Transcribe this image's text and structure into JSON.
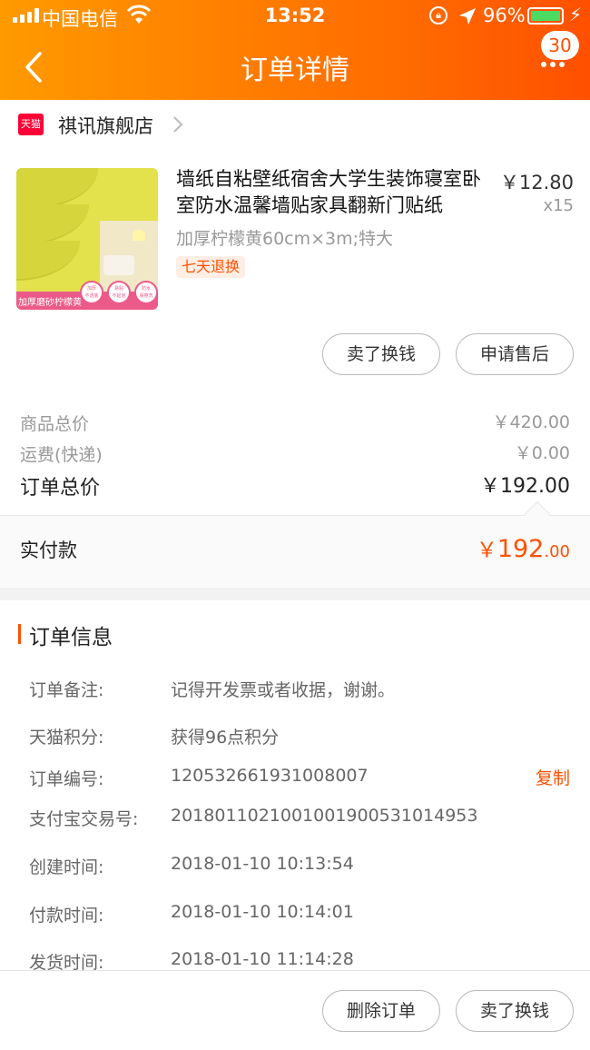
{
  "status_bar": {
    "carrier": "中国电信",
    "time": "13:52",
    "battery": "96%",
    "battery_level": 0.96
  },
  "nav": {
    "title": "订单详情",
    "badge": "30"
  },
  "shop": {
    "logo_text": "天猫",
    "name": "祺讯旗舰店"
  },
  "product": {
    "title": "墙纸自粘壁纸宿舍大学生装饰寝室卧室防水温馨墙贴家具翻新门贴纸",
    "price": "￥12.80",
    "quantity": "x15",
    "spec": "加厚柠檬黄60cm×3m;特大",
    "tag": "七天退换",
    "image_caption": "加厚磨砂柠檬黄"
  },
  "product_actions": {
    "sell_label": "卖了换钱",
    "after_sale_label": "申请售后"
  },
  "summary": {
    "goods_total_label": "商品总价",
    "goods_total_value": "￥420.00",
    "shipping_label": "运费(快递)",
    "shipping_value": "￥0.00",
    "order_total_label": "订单总价",
    "order_total_value": "￥192.00",
    "paid_label": "实付款",
    "paid_currency": "￥",
    "paid_integer": "192",
    "paid_decimal": ".00"
  },
  "order_info": {
    "title": "订单信息",
    "rows": [
      {
        "label": "订单备注:",
        "value": "记得开发票或者收据，谢谢。"
      },
      {
        "label": "天猫积分:",
        "value": "获得96点积分"
      },
      {
        "label": "订单编号:",
        "value": "120532661931008007"
      },
      {
        "label": "支付宝交易号:",
        "value": "2018011021001001900531014953"
      },
      {
        "label": "创建时间:",
        "value": "2018-01-10 10:13:54"
      },
      {
        "label": "付款时间:",
        "value": "2018-01-10 10:14:01"
      },
      {
        "label": "发货时间:",
        "value": "2018-01-10 11:14:28"
      }
    ],
    "copy_label": "复制"
  },
  "footer": {
    "delete_label": "删除订单",
    "sell_label": "卖了换钱"
  },
  "colors": {
    "accent": "#ff5000",
    "header_start": "#ff9a00",
    "header_end": "#ff5000"
  }
}
